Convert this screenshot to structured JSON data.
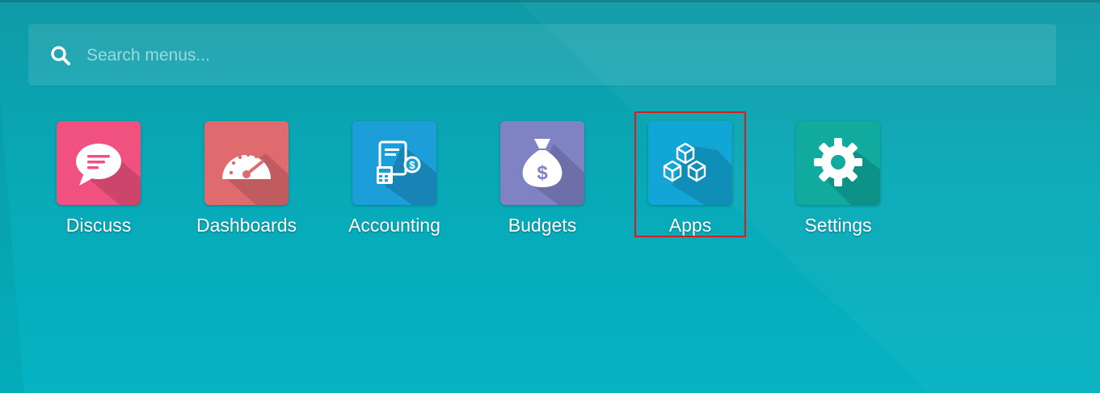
{
  "search": {
    "placeholder": "Search menus...",
    "value": ""
  },
  "apps": [
    {
      "label": "Discuss",
      "icon": "chat-bubble-icon",
      "color": "#f0517e"
    },
    {
      "label": "Dashboards",
      "icon": "speedometer-icon",
      "color": "#e06b6f"
    },
    {
      "label": "Accounting",
      "icon": "invoice-calculator-icon",
      "color": "#1c9ed8"
    },
    {
      "label": "Budgets",
      "icon": "money-bag-icon",
      "color": "#7f83c4"
    },
    {
      "label": "Apps",
      "icon": "cubes-icon",
      "color": "#12a6d6"
    },
    {
      "label": "Settings",
      "icon": "gear-icon",
      "color": "#10aa9f"
    }
  ],
  "highlight": {
    "target": "Apps",
    "color": "#d22020"
  }
}
